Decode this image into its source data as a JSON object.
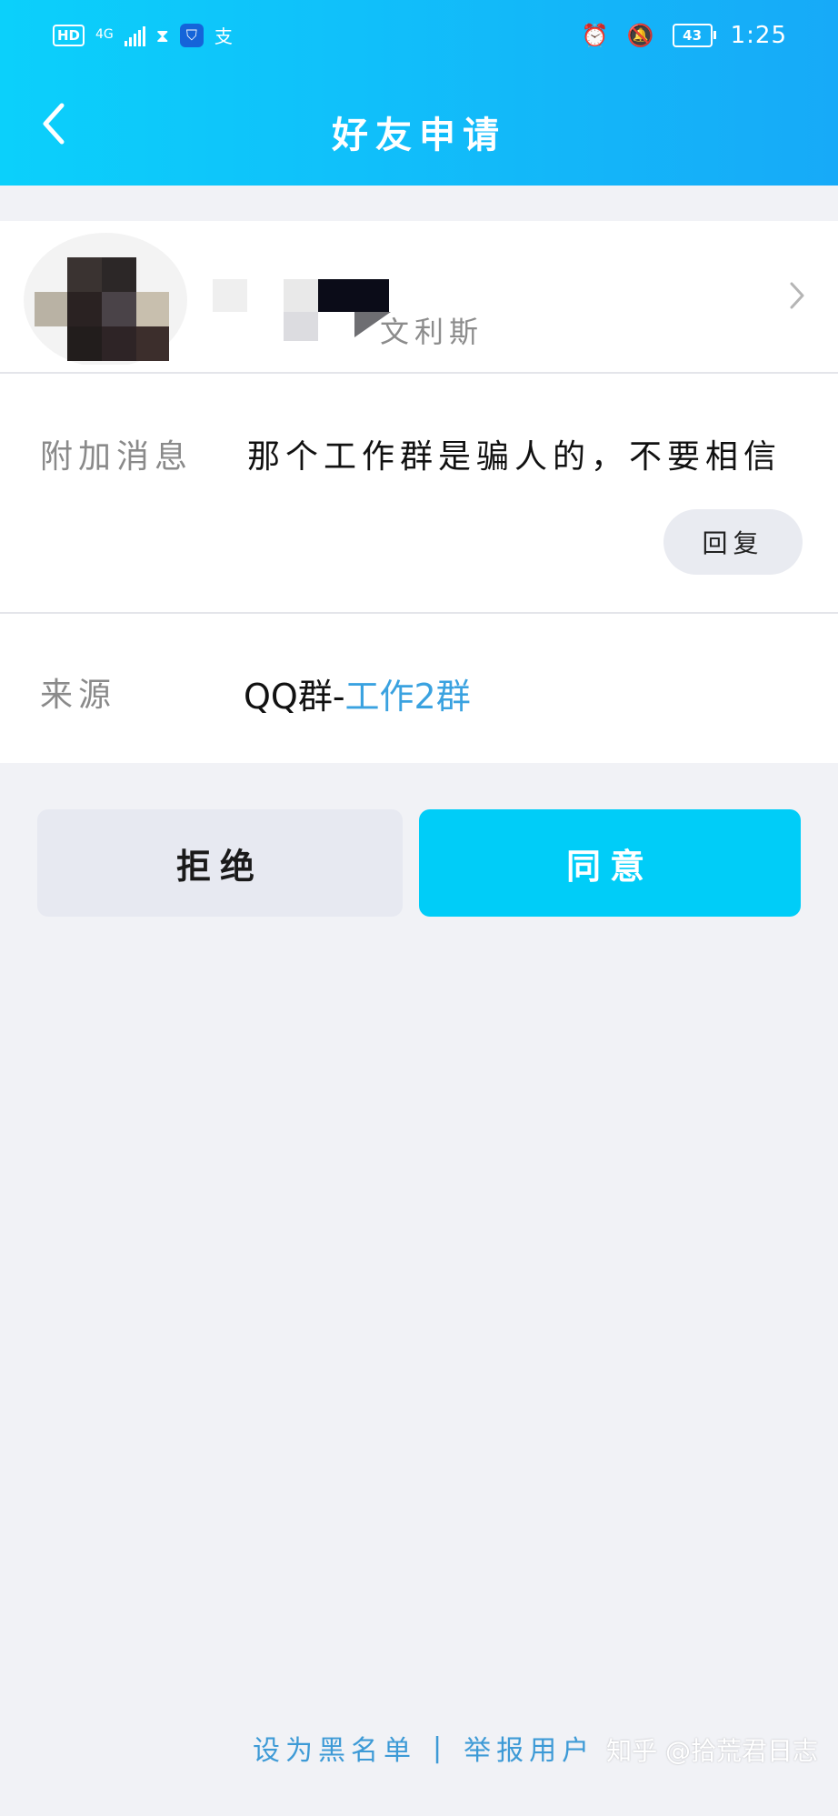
{
  "status_bar": {
    "hd": "HD",
    "network": "4G",
    "alipay": "支",
    "battery": "43",
    "time": "1:25"
  },
  "header": {
    "title": "好友申请",
    "back_icon": "chevron-left-icon"
  },
  "profile": {
    "name_suffix": "文利斯",
    "chevron_icon": "chevron-right-icon"
  },
  "message": {
    "label": "附加消息",
    "text": "那个工作群是骗人的，不要相信",
    "reply_label": "回复"
  },
  "source": {
    "label": "来源",
    "prefix": "QQ群-",
    "group_name": "工作2群"
  },
  "actions": {
    "reject_label": "拒绝",
    "accept_label": "同意"
  },
  "footer": {
    "blacklist_label": "设为黑名单",
    "separator": "|",
    "report_label": "举报用户"
  },
  "watermark": "知乎 @拾荒君日志",
  "colors": {
    "header_gradient_start": "#0bd0fb",
    "header_gradient_end": "#17aaf8",
    "accept": "#00cdf8",
    "link": "#3d9ad6"
  }
}
